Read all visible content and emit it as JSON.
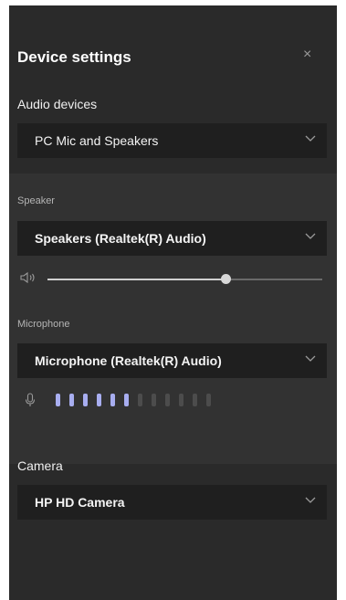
{
  "title": "Device settings",
  "close_glyph": "×",
  "audio_devices": {
    "label": "Audio devices",
    "selected": "PC Mic and Speakers"
  },
  "speaker": {
    "label": "Speaker",
    "selected": "Speakers (Realtek(R) Audio)",
    "volume_fraction": 0.65
  },
  "microphone": {
    "label": "Microphone",
    "selected": "Microphone (Realtek(R) Audio)",
    "level_active": 6,
    "level_total": 12
  },
  "camera": {
    "label": "Camera",
    "selected": "HP HD Camera"
  },
  "icons": [
    "close-icon",
    "chevron-down-icon",
    "speaker-volume-icon",
    "microphone-icon"
  ],
  "colors": {
    "panel": "#2a2a2a",
    "section": "#323232",
    "dropdown": "#1f1f1f",
    "level_active": "#a8aef0",
    "level_inactive": "#4c4c4c"
  }
}
